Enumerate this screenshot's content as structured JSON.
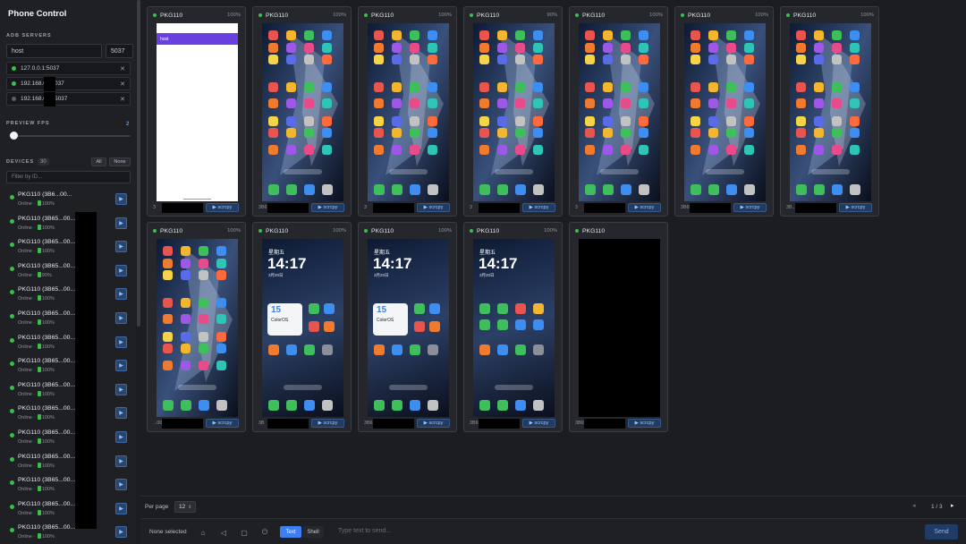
{
  "app": {
    "title": "Phone Control"
  },
  "adb": {
    "label": "ADB SERVERS",
    "host_value": "host",
    "port_value": "5037",
    "servers": [
      {
        "address": "127.0.0.1:5037",
        "status": "online"
      },
      {
        "address": "192.168.0.  :5037",
        "status": "online"
      },
      {
        "address": "192.168.0.  7:5037",
        "status": "offline"
      }
    ]
  },
  "fps": {
    "label": "PREVIEW FPS",
    "value": "2",
    "level": 0.0
  },
  "devices": {
    "label": "DEVICES",
    "count": "30",
    "all_label": "All",
    "none_label": "None",
    "filter_placeholder": "Filter by ID...",
    "items": [
      {
        "name": "PKG110 (3B6...00...",
        "status": "Online · ",
        "battery": "100%"
      },
      {
        "name": "PKG110 (3B65...00...",
        "status": "Online · ",
        "battery": "100%"
      },
      {
        "name": "PKG110 (3B65...00...",
        "status": "Online · ",
        "battery": "100%"
      },
      {
        "name": "PKG110 (3B65...00...",
        "status": "Online · ",
        "battery": "90%"
      },
      {
        "name": "PKG110 (3B65...00...",
        "status": "Online · ",
        "battery": "100%"
      },
      {
        "name": "PKG110 (3B65...00...",
        "status": "Online · ",
        "battery": "100%"
      },
      {
        "name": "PKG110 (3B65...00...",
        "status": "Online · ",
        "battery": "100%"
      },
      {
        "name": "PKG110 (3B65...00...",
        "status": "Online · ",
        "battery": "100%"
      },
      {
        "name": "PKG110 (3B65...00...",
        "status": "Online · ",
        "battery": "100%"
      },
      {
        "name": "PKG110 (3B65...00...",
        "status": "Online · ",
        "battery": "100%"
      },
      {
        "name": "PKG110 (3B65...00...",
        "status": "Online · ",
        "battery": "100%"
      },
      {
        "name": "PKG110 (3B65...00...",
        "status": "Online · ",
        "battery": "100%"
      },
      {
        "name": "PKG110 (3B65...00...",
        "status": "Online · ",
        "battery": "100%"
      },
      {
        "name": "PKG110 (3B65...00...",
        "status": "Online · ",
        "battery": "100%"
      },
      {
        "name": "PKG110 (3B65...00...",
        "status": "Online · ",
        "battery": "100%"
      }
    ]
  },
  "grid": {
    "cards": [
      {
        "model": "PKG110",
        "battery": "100%",
        "id": "3",
        "screen": "white",
        "scrcpy": "scrcpy"
      },
      {
        "model": "PKG110",
        "battery": "100%",
        "id": "3B6",
        "screen": "home",
        "scrcpy": "scrcpy"
      },
      {
        "model": "PKG110",
        "battery": "100%",
        "id": "3",
        "screen": "home",
        "scrcpy": "scrcpy"
      },
      {
        "model": "PKG110",
        "battery": "90%",
        "id": "3",
        "screen": "home",
        "scrcpy": "scrcpy"
      },
      {
        "model": "PKG110",
        "battery": "100%",
        "id": "3",
        "screen": "home",
        "scrcpy": "scrcpy"
      },
      {
        "model": "PKG110",
        "battery": "100%",
        "id": "3B65...0000",
        "screen": "home",
        "scrcpy": "scrcpy"
      },
      {
        "model": "PKG110",
        "battery": "100%",
        "id": "3B...00",
        "screen": "home",
        "scrcpy": "scrcpy"
      },
      {
        "model": "PKG110",
        "battery": "100%",
        "id": "...0000",
        "screen": "home",
        "scrcpy": "scrcpy"
      },
      {
        "model": "PKG110",
        "battery": "100%",
        "id": "3B",
        "screen": "lock",
        "scrcpy": "scrcpy"
      },
      {
        "model": "PKG110",
        "battery": "100%",
        "id": "3B6...0",
        "screen": "lock",
        "scrcpy": "scrcpy"
      },
      {
        "model": "PKG110",
        "battery": "100%",
        "id": "3B65B...00",
        "screen": "lock2",
        "scrcpy": "scrcpy"
      },
      {
        "model": "PKG110",
        "battery": "",
        "id": "3B65AU...00",
        "screen": "black",
        "scrcpy": "scrcpy"
      }
    ],
    "white_app_label": "host",
    "lock_weekday": "星期五",
    "lock_time": "14:17",
    "lock_date": "3月20日",
    "coloros_num": "15",
    "coloros_name": "ColorOS"
  },
  "pager": {
    "per_page_label": "Per page",
    "per_page_value": "12",
    "page_text": "1 / 3"
  },
  "bottom": {
    "selected_text": "None selected",
    "text_tab": "Text",
    "shell_tab": "Shell",
    "input_placeholder": "Type text to send...",
    "send_label": "Send"
  },
  "colors": {
    "accent": "#3d7ef0",
    "online": "#37c04a"
  }
}
